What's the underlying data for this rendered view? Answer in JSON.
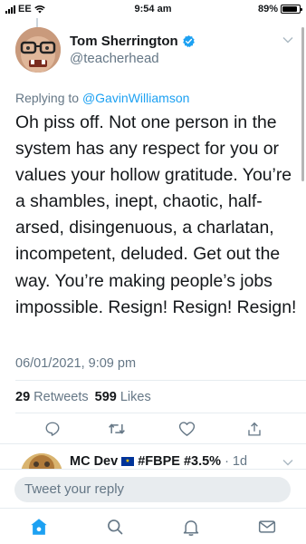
{
  "status_bar": {
    "carrier": "EE",
    "time": "9:54 am",
    "battery": "89%",
    "battery_level": 0.89
  },
  "tweet": {
    "author_name": "Tom Sherrington",
    "author_handle": "@teacherhead",
    "replying_to_prefix": "Replying to ",
    "replying_to_handle": "@GavinWilliamson",
    "text": "Oh piss off. Not one person in the system has any respect for you or values your hollow gratitude. You’re a shambles, inept, chaotic, half-arsed, disingenuous, a charlatan, incompetent, deluded. Get out the way. You’re making people’s jobs  impossible. Resign! Resign! Resign!",
    "timestamp": "06/01/2021, 9:09 pm",
    "retweets_count": "29",
    "retweets_label": "Retweets",
    "likes_count": "599",
    "likes_label": "Likes",
    "icons": {
      "verified": "verified-badge-icon",
      "reply": "reply-icon",
      "retweet": "retweet-icon",
      "like": "heart-icon",
      "share": "share-icon"
    }
  },
  "next_tweet": {
    "author_name": "MC Dev",
    "flag_icon": "eu-flag-icon",
    "hashtags": "#FBPE #3.5%",
    "separator": "·",
    "age": "1d"
  },
  "compose": {
    "placeholder": "Tweet your reply"
  },
  "tab_bar": {
    "items": [
      "home-icon",
      "search-icon",
      "notifications-icon",
      "messages-icon"
    ],
    "active": "home-icon",
    "accent_color": "#1da1f2"
  }
}
